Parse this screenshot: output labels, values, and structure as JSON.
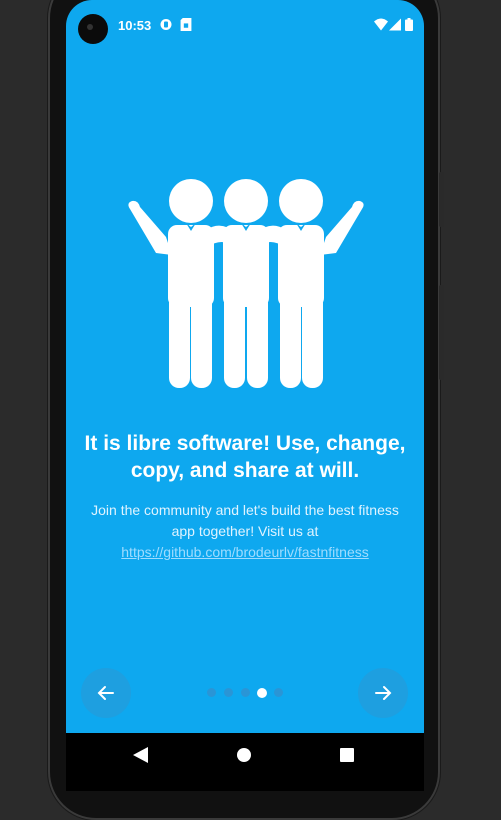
{
  "status_bar": {
    "time": "10:53",
    "icons": [
      "vpn-key-icon",
      "sim-card-icon",
      "wifi-icon",
      "signal-icon",
      "battery-icon"
    ]
  },
  "onboarding": {
    "illustration": "community-people-icon",
    "title": "It is libre software! Use, change, copy, and share at will.",
    "description_prefix": "Join the community and let's build the best fitness app together! Visit us at ",
    "link_text": "https://github.com/brodeurlv/fastnfitness",
    "page_count": 5,
    "current_page": 4
  },
  "navigation": {
    "back_icon": "arrow-left-icon",
    "next_icon": "arrow-right-icon"
  },
  "system_nav": {
    "back_icon": "triangle-back-icon",
    "home_icon": "circle-home-icon",
    "recents_icon": "square-recents-icon"
  },
  "colors": {
    "background": "#0ea8ef",
    "accent_dark": "#1e9fe0",
    "text": "#ffffff"
  }
}
